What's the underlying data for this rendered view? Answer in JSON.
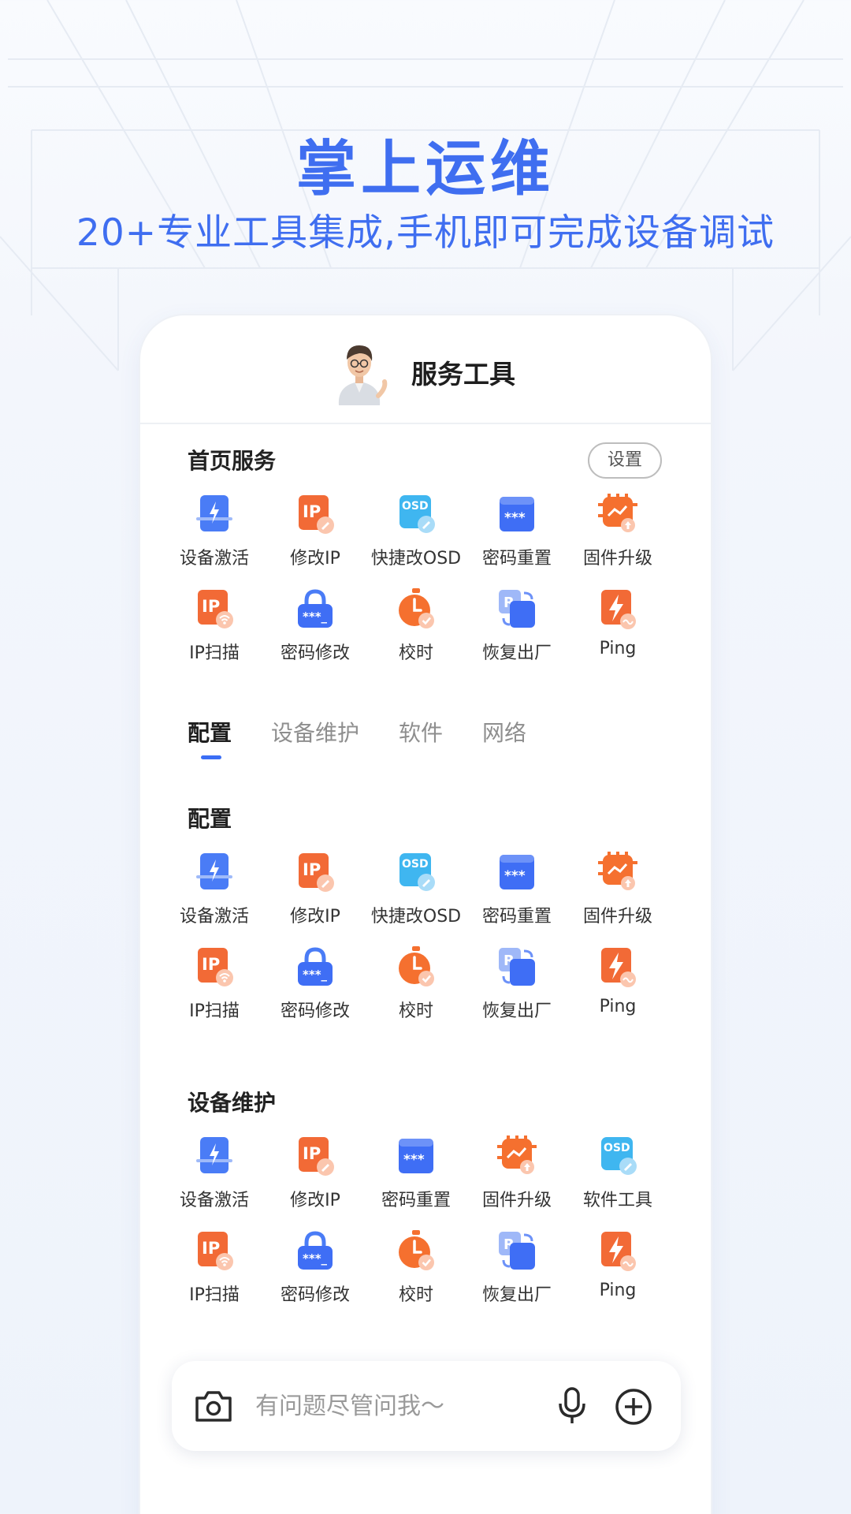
{
  "hero": {
    "title": "掌上运维",
    "subtitle": "20+专业工具集成,手机即可完成设备调试"
  },
  "header": {
    "title": "服务工具"
  },
  "home": {
    "title": "首页服务",
    "settings_label": "设置",
    "tools": [
      {
        "label": "设备激活",
        "icon": "device-activate-icon"
      },
      {
        "label": "修改IP",
        "icon": "modify-ip-icon"
      },
      {
        "label": "快捷改OSD",
        "icon": "osd-edit-icon"
      },
      {
        "label": "密码重置",
        "icon": "password-reset-icon"
      },
      {
        "label": "固件升级",
        "icon": "firmware-upgrade-icon"
      },
      {
        "label": "IP扫描",
        "icon": "ip-scan-icon"
      },
      {
        "label": "密码修改",
        "icon": "password-lock-icon"
      },
      {
        "label": "校时",
        "icon": "time-sync-icon"
      },
      {
        "label": "恢复出厂",
        "icon": "factory-reset-icon"
      },
      {
        "label": "Ping",
        "icon": "ping-icon"
      }
    ]
  },
  "tabs": [
    {
      "label": "配置",
      "active": true
    },
    {
      "label": "设备维护",
      "active": false
    },
    {
      "label": "软件",
      "active": false
    },
    {
      "label": "网络",
      "active": false
    }
  ],
  "config": {
    "title": "配置",
    "tools": [
      {
        "label": "设备激活",
        "icon": "device-activate-icon"
      },
      {
        "label": "修改IP",
        "icon": "modify-ip-icon"
      },
      {
        "label": "快捷改OSD",
        "icon": "osd-edit-icon"
      },
      {
        "label": "密码重置",
        "icon": "password-reset-icon"
      },
      {
        "label": "固件升级",
        "icon": "firmware-upgrade-icon"
      },
      {
        "label": "IP扫描",
        "icon": "ip-scan-icon"
      },
      {
        "label": "密码修改",
        "icon": "password-lock-icon"
      },
      {
        "label": "校时",
        "icon": "time-sync-icon"
      },
      {
        "label": "恢复出厂",
        "icon": "factory-reset-icon"
      },
      {
        "label": "Ping",
        "icon": "ping-icon"
      }
    ]
  },
  "maintenance": {
    "title": "设备维护",
    "tools": [
      {
        "label": "设备激活",
        "icon": "device-activate-icon"
      },
      {
        "label": "修改IP",
        "icon": "modify-ip-icon"
      },
      {
        "label": "密码重置",
        "icon": "password-reset-icon"
      },
      {
        "label": "固件升级",
        "icon": "firmware-upgrade-icon"
      },
      {
        "label": "软件工具",
        "icon": "osd-edit-icon"
      },
      {
        "label": "IP扫描",
        "icon": "ip-scan-icon"
      },
      {
        "label": "密码修改",
        "icon": "password-lock-icon"
      },
      {
        "label": "校时",
        "icon": "time-sync-icon"
      },
      {
        "label": "恢复出厂",
        "icon": "factory-reset-icon"
      },
      {
        "label": "Ping",
        "icon": "ping-icon"
      }
    ]
  },
  "chat": {
    "placeholder": "有问题尽管问我～"
  },
  "colors": {
    "accent": "#3f6ef0",
    "orange": "#f5702f",
    "blue": "#3f6ef5"
  }
}
